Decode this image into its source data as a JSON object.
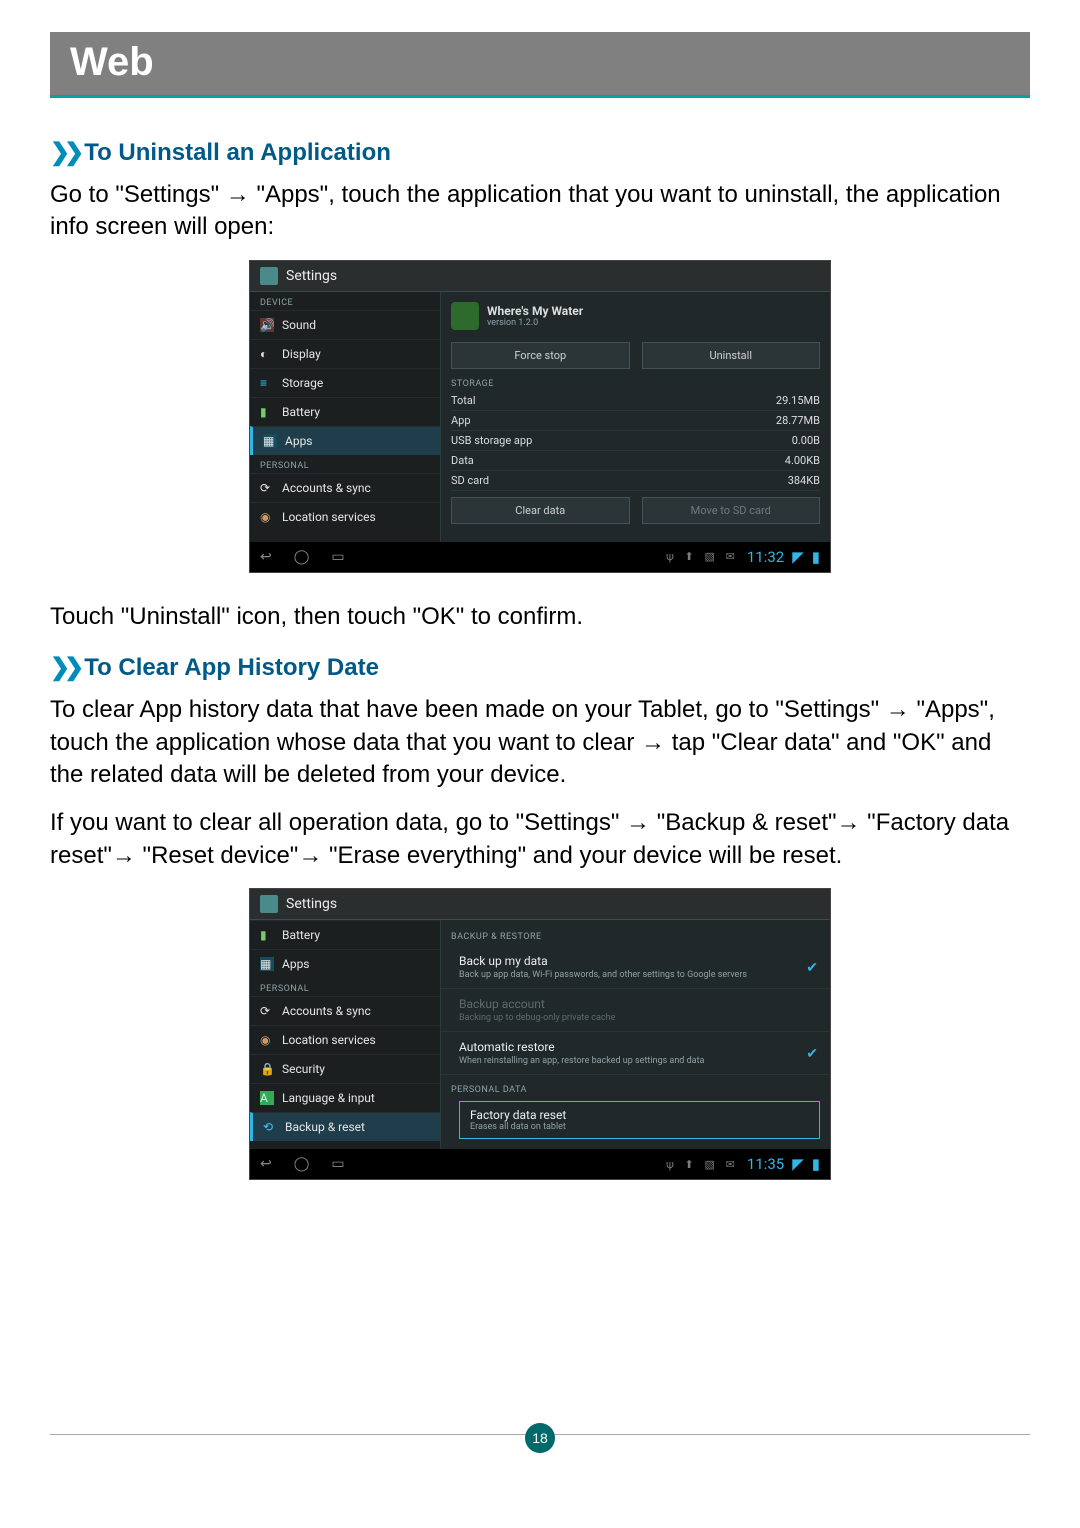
{
  "page": {
    "title": "Web",
    "number": "18"
  },
  "section1": {
    "heading": "To Uninstall an Application",
    "para1": "Go to \"Settings\" → \"Apps\", touch the application that you want to uninstall, the application info screen will open:",
    "para2": "Touch \"Uninstall\" icon, then touch \"OK\" to confirm."
  },
  "section2": {
    "heading": "To Clear App History Date",
    "para1": "To clear App history data that have been made on your Tablet, go to \"Settings\" → \"Apps\", touch the application whose data that you want to clear → tap \"Clear data\" and \"OK\" and the related data will be deleted from your device.",
    "para2": "If you want to clear all operation data, go to \"Settings\" → \"Backup & reset\"→ \"Factory data reset\"→ \"Reset device\"→ \"Erase everything\" and your device will be reset."
  },
  "shot1": {
    "title": "Settings",
    "cat_device": "DEVICE",
    "cat_personal": "PERSONAL",
    "nav": {
      "sound": "Sound",
      "display": "Display",
      "storage": "Storage",
      "battery": "Battery",
      "apps": "Apps",
      "accounts": "Accounts & sync",
      "location": "Location services"
    },
    "app": {
      "name": "Where's My Water",
      "version": "version 1.2.0"
    },
    "buttons": {
      "force_stop": "Force stop",
      "uninstall": "Uninstall",
      "clear_data": "Clear data",
      "move_sd": "Move to SD card"
    },
    "storage_header": "STORAGE",
    "rows": {
      "total_k": "Total",
      "total_v": "29.15MB",
      "app_k": "App",
      "app_v": "28.77MB",
      "usb_k": "USB storage app",
      "usb_v": "0.00B",
      "data_k": "Data",
      "data_v": "4.00KB",
      "sd_k": "SD card",
      "sd_v": "384KB"
    },
    "time": "11:32"
  },
  "shot2": {
    "title": "Settings",
    "cat_personal": "PERSONAL",
    "nav": {
      "battery": "Battery",
      "apps": "Apps",
      "accounts": "Accounts & sync",
      "location": "Location services",
      "security": "Security",
      "language": "Language & input",
      "backup": "Backup & reset"
    },
    "headers": {
      "backup_restore": "BACKUP & RESTORE",
      "personal_data": "PERSONAL DATA"
    },
    "opts": {
      "bmd_t": "Back up my data",
      "bmd_d": "Back up app data, Wi-Fi passwords, and other settings to Google servers",
      "ba_t": "Backup account",
      "ba_d": "Backing up to debug-only private cache",
      "ar_t": "Automatic restore",
      "ar_d": "When reinstalling an app, restore backed up settings and data",
      "fdr_t": "Factory data reset",
      "fdr_d": "Erases all data on tablet"
    },
    "time": "11:35"
  }
}
